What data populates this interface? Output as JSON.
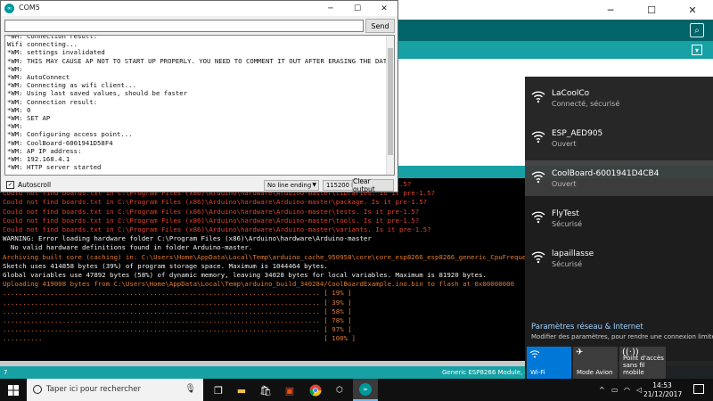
{
  "serial_monitor": {
    "title": "COM5",
    "send_label": "Send",
    "input_value": "",
    "lines": [
      "*WM: Connection result:",
      "Wifi connecting...",
      "*WM: settings invalidated",
      "*WM: THIS MAY CAUSE AP NOT TO START UP PROPERLY. YOU NEED TO COMMENT IT OUT AFTER ERASING THE DATA.",
      "*WM:",
      "*WM: AutoConnect",
      "*WM: Connecting as wifi client...",
      "*WM: Using last saved values, should be faster",
      "*WM: Connection result:",
      "*WM: 0",
      "*WM: SET AP",
      "*WM:",
      "*WM: Configuring access point...",
      "*WM: CoolBoard-6001941D58F4",
      "*WM: AP IP address:",
      "*WM: 192.168.4.1",
      "*WM: HTTP server started"
    ],
    "autoscroll_label": "Autoscroll",
    "autoscroll_checked": "✓",
    "line_ending": "No line ending",
    "baud": "115200 baud",
    "clear_label": "Clear output"
  },
  "ide": {
    "console_lines": [
      {
        "text": "Could not find boards.txt in C:\\Program Files (x86)\\Arduino\\hardware\\Arduino-master\\doc. Is it pre-1.5?",
        "color": "red"
      },
      {
        "text": "Could not find boards.txt in C:\\Program Files (x86)\\Arduino\\hardware\\Arduino-master\\libraries. Is it pre-1.5?",
        "color": "red"
      },
      {
        "text": "Could not find boards.txt in C:\\Program Files (x86)\\Arduino\\hardware\\Arduino-master\\package. Is it pre-1.5?",
        "color": "red"
      },
      {
        "text": "Could not find boards.txt in C:\\Program Files (x86)\\Arduino\\hardware\\Arduino-master\\tests. Is it pre-1.5?",
        "color": "red"
      },
      {
        "text": "Could not find boards.txt in C:\\Program Files (x86)\\Arduino\\hardware\\Arduino-master\\tools. Is it pre-1.5?",
        "color": "red"
      },
      {
        "text": "Could not find boards.txt in C:\\Program Files (x86)\\Arduino\\hardware\\Arduino-master\\variants. Is it pre-1.5?",
        "color": "red"
      },
      {
        "text": "WARNING: Error loading hardware folder C:\\Program Files (x86)\\Arduino\\hardware\\Arduino-master",
        "color": "white"
      },
      {
        "text": "  No valid hardware definitions found in folder Arduino-master.",
        "color": "white"
      },
      {
        "text": "Archiving built core (caching) in: C:\\Users\\Home\\AppData\\Local\\Temp\\arduino_cache_950958\\core\\core_esp8266_esp8266_generic_CpuFrequency_80,Flas",
        "color": "orange"
      },
      {
        "text": "Sketch uses 414858 bytes (39%) of program storage space. Maximum is 1044464 bytes.",
        "color": "white"
      },
      {
        "text": "Global variables use 47892 bytes (58%) of dynamic memory, leaving 34028 bytes for local variables. Maximum is 81920 bytes.",
        "color": "white"
      },
      {
        "text": "Uploading 419008 bytes from C:\\Users\\Home\\AppData\\Local\\Temp\\arduino_build_340284/CoolBoardExample.ino.bin to flash at 0x00000000",
        "color": "orange"
      },
      {
        "text": "................................................................................ [ 19% ]",
        "color": "orange"
      },
      {
        "text": "................................................................................ [ 39% ]",
        "color": "orange"
      },
      {
        "text": "................................................................................ [ 58% ]",
        "color": "orange"
      },
      {
        "text": "................................................................................ [ 78% ]",
        "color": "orange"
      },
      {
        "text": "................................................................................ [ 97% ]",
        "color": "orange"
      },
      {
        "text": "..........                                                                       [ 100% ]",
        "color": "orange"
      }
    ],
    "line_number": "7",
    "board_info": "Generic ESP8266 Module, 80 MHz"
  },
  "network": {
    "items": [
      {
        "name": "LaCoolCo",
        "status": "Connecté, sécurisé",
        "selected": false
      },
      {
        "name": "ESP_AED905",
        "status": "Ouvert",
        "selected": false
      },
      {
        "name": "CoolBoard-6001941D4CB4",
        "status": "Ouvert",
        "selected": true
      },
      {
        "name": "FlyTest",
        "status": "Sécurisé",
        "selected": false
      },
      {
        "name": "lapaillasse",
        "status": "Sécurisé",
        "selected": false
      }
    ],
    "settings_link": "Paramètres réseau & Internet",
    "settings_desc": "Modifier des paramètres, pour rendre une connexion limitée.",
    "tiles": {
      "wifi": "Wi-Fi",
      "airplane": "Mode Avion",
      "hotspot_line1": "Point d'accès",
      "hotspot_line2": "sans fil mobile"
    }
  },
  "taskbar": {
    "search_placeholder": "Taper ici pour rechercher",
    "time": "14:53",
    "date": "21/12/2017"
  },
  "colors": {
    "arduino_teal": "#17a1a5",
    "arduino_dark": "#006468",
    "windows_accent": "#0078d7",
    "console_red": "#e2432e",
    "console_orange": "#e47a2c"
  }
}
